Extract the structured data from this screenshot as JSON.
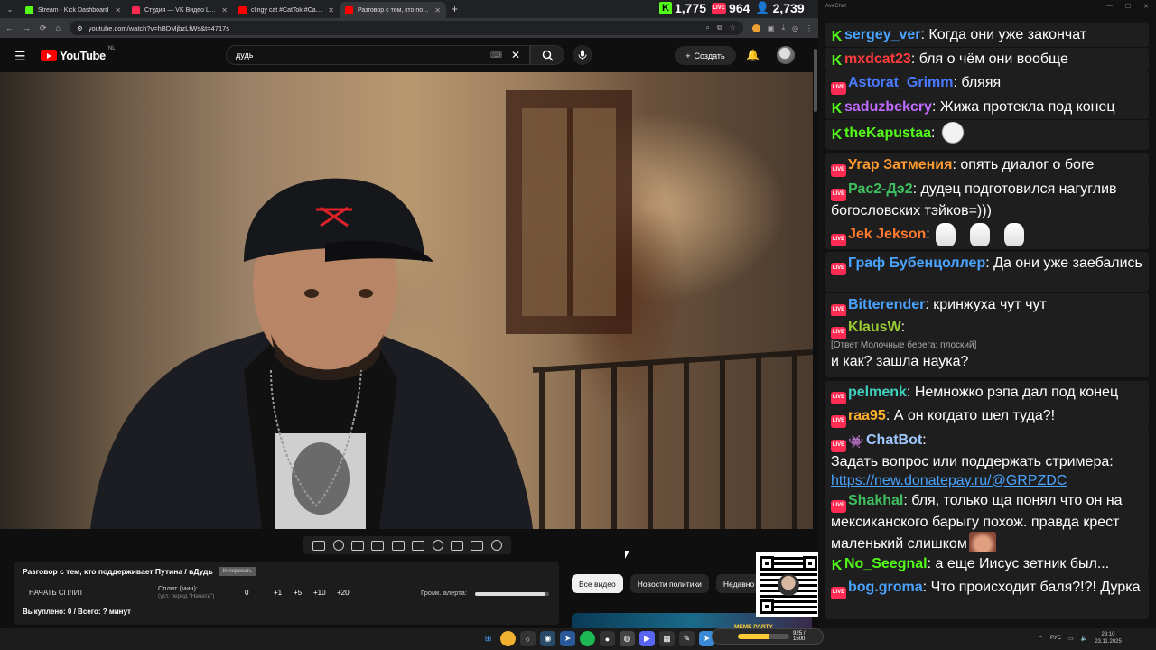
{
  "browser": {
    "tabs": [
      {
        "title": "Stream - Kick Dashboard",
        "color": "#53fc18",
        "active": false
      },
      {
        "title": "Студия — VK Видео Live",
        "color": "#ff2b52",
        "active": false
      },
      {
        "title": "clingy cat #CatTok #CatFails20...",
        "color": "#ff0000",
        "active": false
      },
      {
        "title": "Разговор с тем, кто подде...",
        "color": "#ff0000",
        "active": true
      }
    ],
    "url": "youtube.com/watch?v=hBDMjbzLfWs&t=4717s"
  },
  "counters": {
    "kick": "1,775",
    "live": "964",
    "users": "2,739",
    "live_badge": "LIVE"
  },
  "youtube": {
    "logo": "YouTube",
    "region": "NL",
    "search_value": "дудь",
    "create_label": "Создать"
  },
  "split_panel": {
    "title": "Разговор с тем, кто поддерживает Путина / вДудь",
    "copy_label": "Копировать",
    "start_label": "НАЧАТЬ СПЛИТ",
    "split_label": "Сплит (мин):",
    "split_sub": "(уст. перед \"Начать\")",
    "value": "0",
    "increments": [
      "+1",
      "+5",
      "+10",
      "+20"
    ],
    "volume_label": "Громк. алерта:",
    "volume_level": 0.95,
    "bought": "Выкуплено: 0 / Всего: ? минут"
  },
  "chips": [
    "Все видео",
    "Новости политики",
    "Недавно"
  ],
  "chat": {
    "title": "AveChat",
    "messages": [
      {
        "badge": "kick",
        "nick": "sergey_ver",
        "color": "#4aa3ff",
        "text": "Когда они уже закончат"
      },
      {
        "badge": "kick",
        "nick": "mxdcat23",
        "color": "#ff3b3b",
        "text": "бля о чём они вообще"
      },
      {
        "badge": "live",
        "nick": "Astorat_Grimm",
        "color": "#4a7aff",
        "text": "бляяя"
      },
      {
        "badge": "kick",
        "nick": "saduzbekcry",
        "color": "#c06bff",
        "text": "Жижа протекла под конец"
      },
      {
        "badge": "kick",
        "nick": "theKapustaa",
        "color": "#53fc18",
        "text": ""
      },
      {
        "badge": "live",
        "nick": "Угар Затмения",
        "color": "#ff9a2e",
        "text": "опять диалог о боге"
      },
      {
        "badge": "live",
        "nick": "Рас2-Дэ2",
        "color": "#3fbf5f",
        "text": "дудец подготовился нагуглив богословских тэйков=)))"
      },
      {
        "badge": "live",
        "nick": "Jek Jekson",
        "color": "#ff7a2e",
        "text": ""
      },
      {
        "badge": "live",
        "nick": "Граф Бубенцоллер",
        "color": "#4aa3ff",
        "text": "Да они уже заебались"
      },
      {
        "badge": "live",
        "nick": "Bitterender",
        "color": "#4aa3ff",
        "text": "кринжуха чут чут"
      },
      {
        "badge": "live",
        "nick": "KlausW",
        "color": "#9acd32",
        "reply": "[Ответ Молочные берега: плоский]",
        "text": "и как? зашла наука?"
      },
      {
        "badge": "live",
        "nick": "pelmenk",
        "color": "#3fd0c0",
        "text": "Немножко рэпа дал под конец"
      },
      {
        "badge": "live",
        "nick": "raa95",
        "color": "#ffb02e",
        "text": "А он когдато шел туда?!"
      },
      {
        "badge": "live+bot",
        "nick": "ChatBot",
        "color": "#a0c8ff",
        "text": "Задать вопрос или поддержать стримера:",
        "link": "https://new.donatepay.ru/@GRPZDC"
      },
      {
        "badge": "live",
        "nick": "Shakhal",
        "color": "#3fbf5f",
        "text": "бля, только ща понял что он на мексиканского барыгу похож. правда крест маленький слишком"
      },
      {
        "badge": "kick",
        "nick": "No_Seegnal",
        "color": "#53fc18",
        "text": "а еще Иисус зетник был..."
      },
      {
        "badge": "live",
        "nick": "bog.groma",
        "color": "#4aa3ff",
        "text": "Что происходит баля?!?! Дурка"
      }
    ]
  },
  "taskbar": {
    "meme_title": "MEME PARTY",
    "meme_progress_text": "925 / 1500",
    "meme_progress": 0.62,
    "lang": "РУС",
    "time": "23:10",
    "date": "23.11.2025"
  }
}
